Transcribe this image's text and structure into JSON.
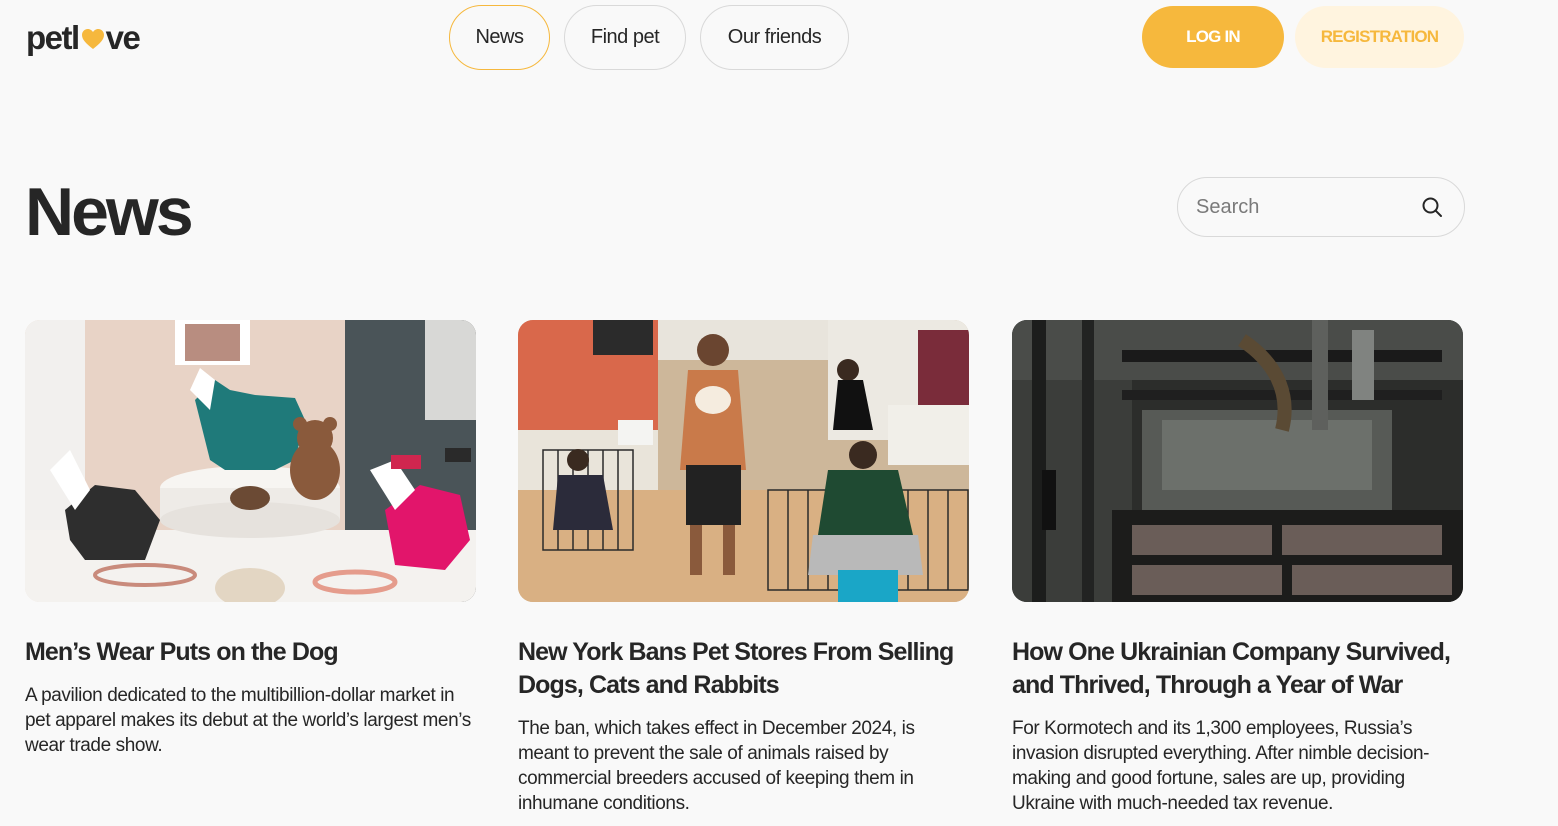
{
  "header": {
    "logo": {
      "prefix": "petl",
      "suffix": "ve",
      "heart_icon": "heart-icon"
    },
    "nav": [
      {
        "label": "News",
        "active": true
      },
      {
        "label": "Find pet",
        "active": false
      },
      {
        "label": "Our friends",
        "active": false
      }
    ],
    "login_label": "LOG IN",
    "registration_label": "REGISTRATION"
  },
  "page": {
    "title": "News",
    "search": {
      "placeholder": "Search",
      "value": "",
      "icon": "search-icon"
    }
  },
  "news": [
    {
      "title": "Men’s Wear Puts on the Dog",
      "text": "A pavilion dedicated to the multibillion-dollar market in pet apparel makes its debut at the world’s largest men’s wear trade show."
    },
    {
      "title": "New York Bans Pet Stores From Selling Dogs, Cats and Rabbits",
      "text": "The ban, which takes effect in December 2024, is meant to prevent the sale of animals raised by commercial breeders accused of keeping them in inhumane conditions."
    },
    {
      "title": "How One Ukrainian Company Survived, and Thrived, Through a Year of War",
      "text": "For Kormotech and its 1,300 employees, Russia’s invasion disrupted everything. After nimble decision-making and good fortune, sales are up, providing Ukraine with much-needed tax revenue."
    }
  ],
  "colors": {
    "accent": "#f6b83d",
    "accent_light": "#fff4df",
    "text": "#262626",
    "background": "#f9f9f9",
    "border": "#d9d9d9"
  }
}
